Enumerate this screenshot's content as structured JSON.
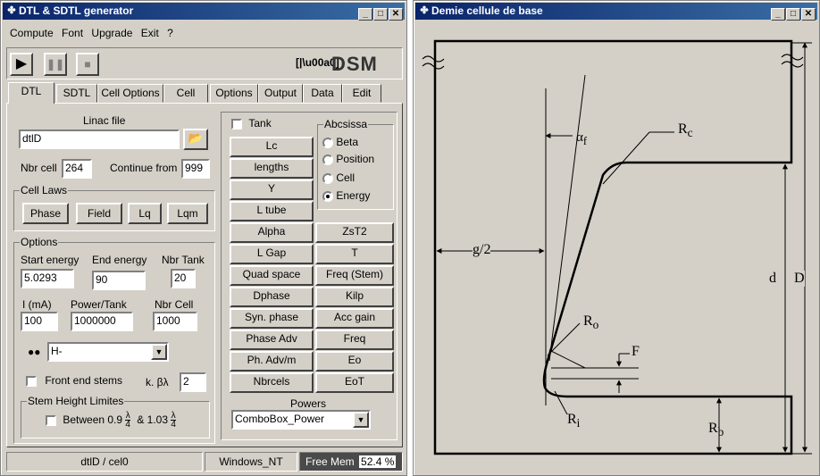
{
  "left": {
    "title": "DTL & SDTL generator",
    "menu": [
      "Compute",
      "Font",
      "Upgrade",
      "Exit",
      "?"
    ],
    "logo": {
      "icon_text": "[|\\u00a0]",
      "text": "DSM"
    },
    "tabs": [
      "DTL",
      "SDTL",
      "Cell Options",
      "Cell",
      "Options",
      "Output",
      "Data",
      "Edit"
    ],
    "linac_file_label": "Linac file",
    "linac_file_value": "dtlD",
    "nbr_cell_label": "Nbr cell",
    "nbr_cell_value": "264",
    "continue_from_label": "Continue from",
    "continue_from_value": "999",
    "cell_laws_label": "Cell Laws",
    "cell_laws_buttons": [
      "Phase",
      "Field",
      "Lq",
      "Lqm"
    ],
    "options_label": "Options",
    "start_energy_label": "Start energy",
    "start_energy_value": "5.0293",
    "end_energy_label": "End energy",
    "end_energy_value": "90",
    "nbr_tank_label": "Nbr Tank",
    "nbr_tank_value": "20",
    "i_ma_label": "I (mA)",
    "i_ma_value": "100",
    "power_tank_label": "Power/Tank",
    "power_tank_value": "1000000",
    "nbr_cell2_label": "Nbr Cell",
    "nbr_cell2_value": "1000",
    "particle_value": "H-",
    "front_end_label": "Front end stems",
    "kbl_label": "k. βλ",
    "kbl_value": "2",
    "stem_label": "Stem Height Limites",
    "between_label": "Between 0.9",
    "and_label": "& 1.03",
    "frac_num": "λ",
    "frac_den": "4",
    "tank_label": "Tank",
    "abscissa_label": "Abcsissa",
    "abscissa_options": [
      "Beta",
      "Position",
      "Cell",
      "Energy"
    ],
    "abscissa_selected": 3,
    "single_buttons": [
      "Lc",
      "lengths",
      "Y",
      "L tube"
    ],
    "pair_buttons": [
      [
        "Alpha",
        "ZsT2"
      ],
      [
        "L Gap",
        "T"
      ],
      [
        "Quad space",
        "Freq (Stem)"
      ],
      [
        "Dphase",
        "Kilp"
      ],
      [
        "Syn. phase",
        "Acc gain"
      ],
      [
        "Phase Adv",
        "Freq"
      ],
      [
        "Ph. Adv/m",
        "Eo"
      ],
      [
        "Nbrcels",
        "EoT"
      ]
    ],
    "powers_label": "Powers",
    "powers_value": "ComboBox_Power",
    "status_file": "dtlD  /  cel0",
    "status_os": "Windows_NT",
    "status_mem_label": "Free Mem",
    "status_mem_value": "52.4 %"
  },
  "right": {
    "title": "Demie cellule de base",
    "labels": {
      "rc": "R",
      "rc_sub": "c",
      "alpha": "α",
      "alpha_sub": "f",
      "g2": "g/2",
      "ro": "R",
      "ro_sub": "o",
      "ri": "R",
      "ri_sub": "i",
      "rb": "R",
      "rb_sub": "b",
      "f": "F",
      "d": "d",
      "D": "D"
    }
  }
}
